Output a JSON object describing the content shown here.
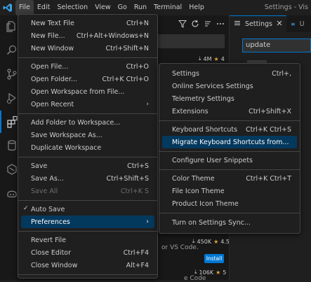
{
  "window_title": "Settings - Vis",
  "menubar": [
    "File",
    "Edit",
    "Selection",
    "View",
    "Go",
    "Run",
    "Terminal",
    "Help"
  ],
  "tabs": [
    {
      "label": "Settings"
    },
    {
      "label": "U"
    }
  ],
  "settings_search_value": "update",
  "extensions": {
    "stats": [
      {
        "downloads": "4M",
        "rating": "4"
      },
      {
        "downloads": "450K",
        "rating": "4.5"
      },
      {
        "downloads": "106K",
        "rating": "5"
      }
    ],
    "desc_partial": "or VS Code.",
    "install_label": "Install",
    "desc_partial2": "e Code"
  },
  "file_menu": [
    {
      "label": "New Text File",
      "key": "Ctrl+N"
    },
    {
      "label": "New File...",
      "key": "Ctrl+Alt+Windows+N"
    },
    {
      "label": "New Window",
      "key": "Ctrl+Shift+N"
    },
    {
      "label": "Open File...",
      "key": "Ctrl+O"
    },
    {
      "label": "Open Folder...",
      "key": "Ctrl+K Ctrl+O"
    },
    {
      "label": "Open Workspace from File...",
      "key": ""
    },
    {
      "label": "Open Recent",
      "key": ""
    },
    {
      "label": "Add Folder to Workspace...",
      "key": ""
    },
    {
      "label": "Save Workspace As...",
      "key": ""
    },
    {
      "label": "Duplicate Workspace",
      "key": ""
    },
    {
      "label": "Save",
      "key": "Ctrl+S"
    },
    {
      "label": "Save As...",
      "key": "Ctrl+Shift+S"
    },
    {
      "label": "Save All",
      "key": "Ctrl+K S"
    },
    {
      "label": "Auto Save",
      "key": ""
    },
    {
      "label": "Preferences",
      "key": ""
    },
    {
      "label": "Revert File",
      "key": ""
    },
    {
      "label": "Close Editor",
      "key": "Ctrl+F4"
    },
    {
      "label": "Close Window",
      "key": "Alt+F4"
    }
  ],
  "preferences_menu": [
    {
      "label": "Settings",
      "key": "Ctrl+,"
    },
    {
      "label": "Online Services Settings",
      "key": ""
    },
    {
      "label": "Telemetry Settings",
      "key": ""
    },
    {
      "label": "Extensions",
      "key": "Ctrl+Shift+X"
    },
    {
      "label": "Keyboard Shortcuts",
      "key": "Ctrl+K Ctrl+S"
    },
    {
      "label": "Migrate Keyboard Shortcuts from...",
      "key": ""
    },
    {
      "label": "Configure User Snippets",
      "key": ""
    },
    {
      "label": "Color Theme",
      "key": "Ctrl+K Ctrl+T"
    },
    {
      "label": "File Icon Theme",
      "key": ""
    },
    {
      "label": "Product Icon Theme",
      "key": ""
    },
    {
      "label": "Turn on Settings Sync...",
      "key": ""
    }
  ],
  "colors": {
    "accent": "#0078d4",
    "selection": "#04395e",
    "star": "#e2a53a"
  }
}
